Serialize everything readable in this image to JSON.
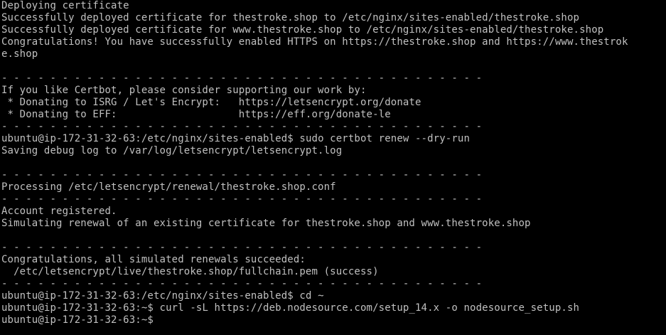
{
  "colors": {
    "background": "#000000",
    "foreground": "#c0c0c0"
  },
  "terminal": {
    "lines": [
      {
        "text": "Deploying certificate"
      },
      {
        "text": "Successfully deployed certificate for thestroke.shop to /etc/nginx/sites-enabled/thestroke.shop"
      },
      {
        "text": "Successfully deployed certificate for www.thestroke.shop to /etc/nginx/sites-enabled/thestroke.shop"
      },
      {
        "text": "Congratulations! You have successfully enabled HTTPS on https://thestroke.shop and https://www.thestrok"
      },
      {
        "text": "e.shop"
      },
      {
        "text": ""
      },
      {
        "text": "- - - - - - - - - - - - - - - - - - - - - - - - - - - - - - - - - - - - - - - -"
      },
      {
        "text": "If you like Certbot, please consider supporting our work by:"
      },
      {
        "text": " * Donating to ISRG / Let's Encrypt:   https://letsencrypt.org/donate"
      },
      {
        "text": " * Donating to EFF:                    https://eff.org/donate-le"
      },
      {
        "text": "- - - - - - - - - - - - - - - - - - - - - - - - - - - - - - - - - - - - - - - -"
      },
      {
        "prompt": "ubuntu@ip-172-31-32-63:/etc/nginx/sites-enabled$",
        "command": " sudo certbot renew --dry-run"
      },
      {
        "text": "Saving debug log to /var/log/letsencrypt/letsencrypt.log"
      },
      {
        "text": ""
      },
      {
        "text": "- - - - - - - - - - - - - - - - - - - - - - - - - - - - - - - - - - - - - - - -"
      },
      {
        "text": "Processing /etc/letsencrypt/renewal/thestroke.shop.conf"
      },
      {
        "text": "- - - - - - - - - - - - - - - - - - - - - - - - - - - - - - - - - - - - - - - -"
      },
      {
        "text": "Account registered."
      },
      {
        "text": "Simulating renewal of an existing certificate for thestroke.shop and www.thestroke.shop"
      },
      {
        "text": ""
      },
      {
        "text": "- - - - - - - - - - - - - - - - - - - - - - - - - - - - - - - - - - - - - - - -"
      },
      {
        "text": "Congratulations, all simulated renewals succeeded:"
      },
      {
        "text": "  /etc/letsencrypt/live/thestroke.shop/fullchain.pem (success)"
      },
      {
        "text": "- - - - - - - - - - - - - - - - - - - - - - - - - - - - - - - - - - - - - - - -"
      },
      {
        "prompt": "ubuntu@ip-172-31-32-63:/etc/nginx/sites-enabled$",
        "command": " cd ~"
      },
      {
        "prompt": "ubuntu@ip-172-31-32-63:~$",
        "command": " curl -sL https://deb.nodesource.com/setup_14.x -o nodesource_setup.sh"
      },
      {
        "prompt": "ubuntu@ip-172-31-32-63:~$",
        "command": ""
      }
    ]
  }
}
